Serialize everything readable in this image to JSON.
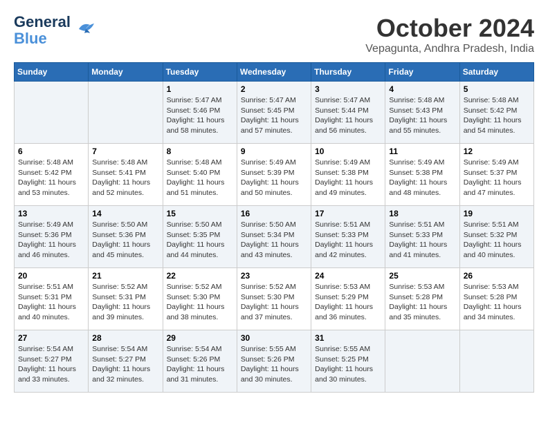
{
  "logo": {
    "line1": "General",
    "line2": "Blue"
  },
  "title": "October 2024",
  "location": "Vepagunta, Andhra Pradesh, India",
  "headers": [
    "Sunday",
    "Monday",
    "Tuesday",
    "Wednesday",
    "Thursday",
    "Friday",
    "Saturday"
  ],
  "weeks": [
    [
      {
        "day": "",
        "info": ""
      },
      {
        "day": "",
        "info": ""
      },
      {
        "day": "1",
        "info": "Sunrise: 5:47 AM\nSunset: 5:46 PM\nDaylight: 11 hours\nand 58 minutes."
      },
      {
        "day": "2",
        "info": "Sunrise: 5:47 AM\nSunset: 5:45 PM\nDaylight: 11 hours\nand 57 minutes."
      },
      {
        "day": "3",
        "info": "Sunrise: 5:47 AM\nSunset: 5:44 PM\nDaylight: 11 hours\nand 56 minutes."
      },
      {
        "day": "4",
        "info": "Sunrise: 5:48 AM\nSunset: 5:43 PM\nDaylight: 11 hours\nand 55 minutes."
      },
      {
        "day": "5",
        "info": "Sunrise: 5:48 AM\nSunset: 5:42 PM\nDaylight: 11 hours\nand 54 minutes."
      }
    ],
    [
      {
        "day": "6",
        "info": "Sunrise: 5:48 AM\nSunset: 5:42 PM\nDaylight: 11 hours\nand 53 minutes."
      },
      {
        "day": "7",
        "info": "Sunrise: 5:48 AM\nSunset: 5:41 PM\nDaylight: 11 hours\nand 52 minutes."
      },
      {
        "day": "8",
        "info": "Sunrise: 5:48 AM\nSunset: 5:40 PM\nDaylight: 11 hours\nand 51 minutes."
      },
      {
        "day": "9",
        "info": "Sunrise: 5:49 AM\nSunset: 5:39 PM\nDaylight: 11 hours\nand 50 minutes."
      },
      {
        "day": "10",
        "info": "Sunrise: 5:49 AM\nSunset: 5:38 PM\nDaylight: 11 hours\nand 49 minutes."
      },
      {
        "day": "11",
        "info": "Sunrise: 5:49 AM\nSunset: 5:38 PM\nDaylight: 11 hours\nand 48 minutes."
      },
      {
        "day": "12",
        "info": "Sunrise: 5:49 AM\nSunset: 5:37 PM\nDaylight: 11 hours\nand 47 minutes."
      }
    ],
    [
      {
        "day": "13",
        "info": "Sunrise: 5:49 AM\nSunset: 5:36 PM\nDaylight: 11 hours\nand 46 minutes."
      },
      {
        "day": "14",
        "info": "Sunrise: 5:50 AM\nSunset: 5:36 PM\nDaylight: 11 hours\nand 45 minutes."
      },
      {
        "day": "15",
        "info": "Sunrise: 5:50 AM\nSunset: 5:35 PM\nDaylight: 11 hours\nand 44 minutes."
      },
      {
        "day": "16",
        "info": "Sunrise: 5:50 AM\nSunset: 5:34 PM\nDaylight: 11 hours\nand 43 minutes."
      },
      {
        "day": "17",
        "info": "Sunrise: 5:51 AM\nSunset: 5:33 PM\nDaylight: 11 hours\nand 42 minutes."
      },
      {
        "day": "18",
        "info": "Sunrise: 5:51 AM\nSunset: 5:33 PM\nDaylight: 11 hours\nand 41 minutes."
      },
      {
        "day": "19",
        "info": "Sunrise: 5:51 AM\nSunset: 5:32 PM\nDaylight: 11 hours\nand 40 minutes."
      }
    ],
    [
      {
        "day": "20",
        "info": "Sunrise: 5:51 AM\nSunset: 5:31 PM\nDaylight: 11 hours\nand 40 minutes."
      },
      {
        "day": "21",
        "info": "Sunrise: 5:52 AM\nSunset: 5:31 PM\nDaylight: 11 hours\nand 39 minutes."
      },
      {
        "day": "22",
        "info": "Sunrise: 5:52 AM\nSunset: 5:30 PM\nDaylight: 11 hours\nand 38 minutes."
      },
      {
        "day": "23",
        "info": "Sunrise: 5:52 AM\nSunset: 5:30 PM\nDaylight: 11 hours\nand 37 minutes."
      },
      {
        "day": "24",
        "info": "Sunrise: 5:53 AM\nSunset: 5:29 PM\nDaylight: 11 hours\nand 36 minutes."
      },
      {
        "day": "25",
        "info": "Sunrise: 5:53 AM\nSunset: 5:28 PM\nDaylight: 11 hours\nand 35 minutes."
      },
      {
        "day": "26",
        "info": "Sunrise: 5:53 AM\nSunset: 5:28 PM\nDaylight: 11 hours\nand 34 minutes."
      }
    ],
    [
      {
        "day": "27",
        "info": "Sunrise: 5:54 AM\nSunset: 5:27 PM\nDaylight: 11 hours\nand 33 minutes."
      },
      {
        "day": "28",
        "info": "Sunrise: 5:54 AM\nSunset: 5:27 PM\nDaylight: 11 hours\nand 32 minutes."
      },
      {
        "day": "29",
        "info": "Sunrise: 5:54 AM\nSunset: 5:26 PM\nDaylight: 11 hours\nand 31 minutes."
      },
      {
        "day": "30",
        "info": "Sunrise: 5:55 AM\nSunset: 5:26 PM\nDaylight: 11 hours\nand 30 minutes."
      },
      {
        "day": "31",
        "info": "Sunrise: 5:55 AM\nSunset: 5:25 PM\nDaylight: 11 hours\nand 30 minutes."
      },
      {
        "day": "",
        "info": ""
      },
      {
        "day": "",
        "info": ""
      }
    ]
  ]
}
